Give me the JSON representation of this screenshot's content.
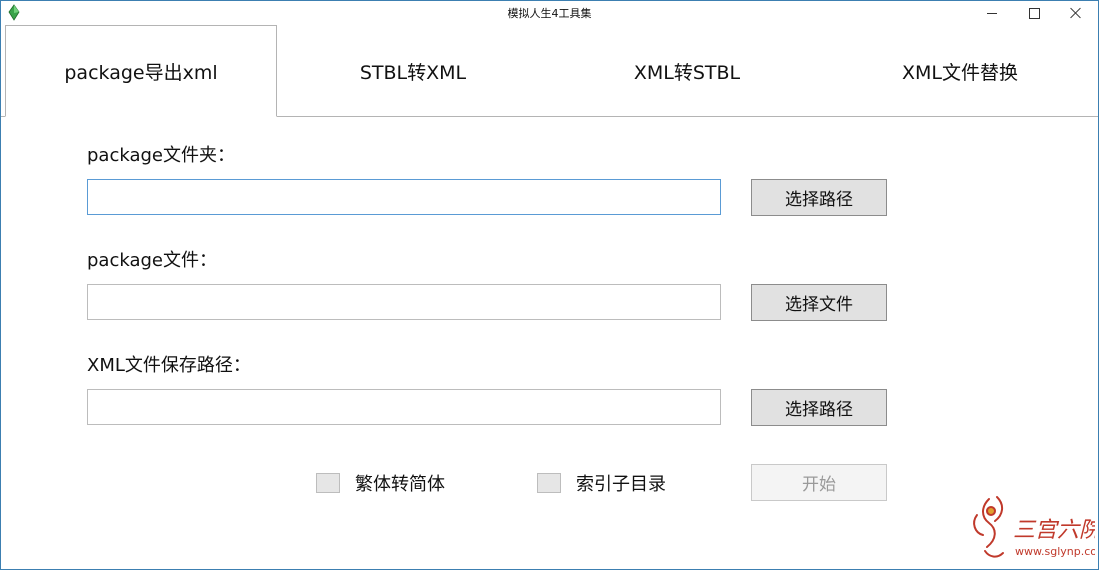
{
  "window": {
    "title": "模拟人生4工具集",
    "icon": "plumbob-icon"
  },
  "tabs": [
    {
      "label": "package导出xml",
      "active": true
    },
    {
      "label": "STBL转XML",
      "active": false
    },
    {
      "label": "XML转STBL",
      "active": false
    },
    {
      "label": "XML文件替换",
      "active": false
    }
  ],
  "form": {
    "folder": {
      "label": "package文件夹：",
      "value": "",
      "button": "选择路径"
    },
    "file": {
      "label": "package文件：",
      "value": "",
      "button": "选择文件"
    },
    "save_path": {
      "label": "XML文件保存路径：",
      "value": "",
      "button": "选择路径"
    },
    "options": [
      {
        "label": "繁体转简体",
        "checked": false
      },
      {
        "label": "索引子目录",
        "checked": false
      }
    ],
    "start_button": "开始"
  },
  "watermark": {
    "text": "三宫六院",
    "url": "www.sglynp.com"
  },
  "colors": {
    "accent": "#3c7fb1",
    "focus_border": "#5a9bd5",
    "button_bg": "#e1e1e1",
    "watermark": "#c0392b"
  }
}
